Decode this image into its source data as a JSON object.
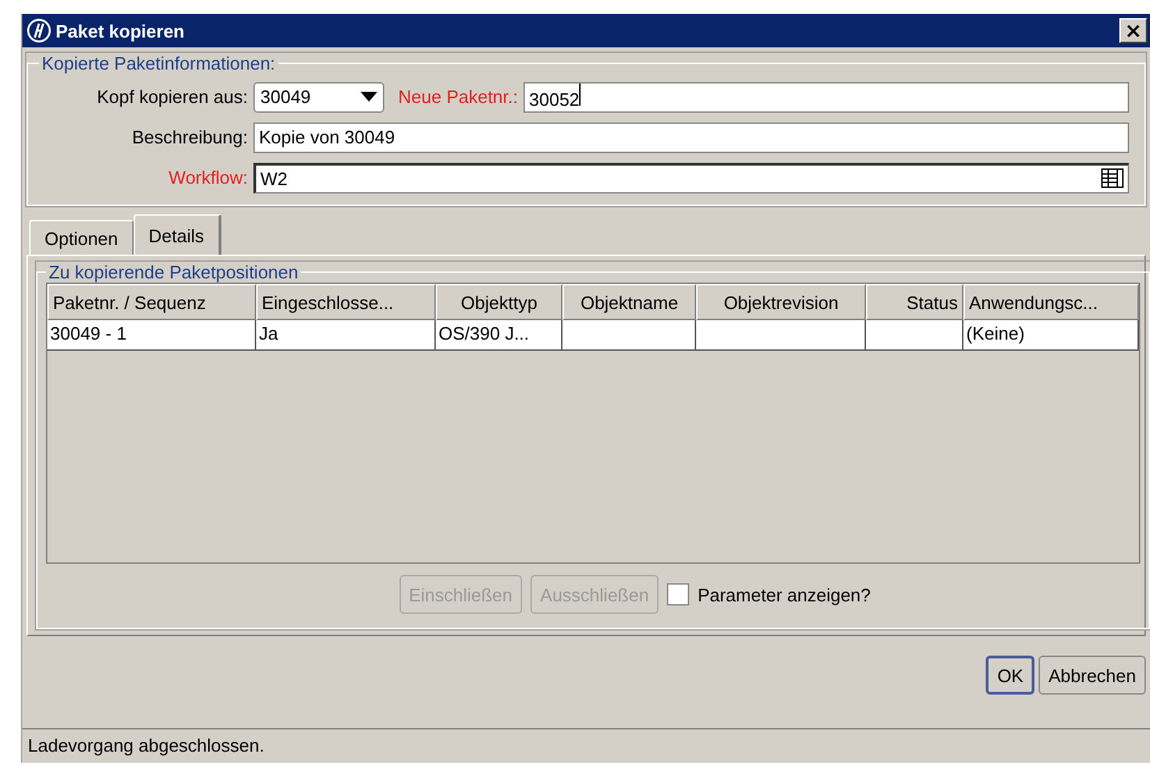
{
  "window": {
    "title": "Paket kopieren",
    "close": "×"
  },
  "info_group": {
    "title": "Kopierte Paketinformationen:",
    "fields": [
      {
        "kind": "combo",
        "label": "Kopf kopieren aus:",
        "required": false,
        "value": "30049"
      },
      {
        "kind": "text",
        "label": "Neue Paketnr.:",
        "required": true,
        "value": "30052"
      },
      {
        "kind": "text",
        "label": "Beschreibung:",
        "required": false,
        "value": "Kopie von 30049"
      },
      {
        "kind": "lookup",
        "label": "Workflow:",
        "required": true,
        "value": "W2"
      }
    ]
  },
  "tabs": [
    {
      "label": "Optionen",
      "selected": false
    },
    {
      "label": "Details",
      "selected": true
    }
  ],
  "positions_group": {
    "title": "Zu kopierende Paketpositionen",
    "table": {
      "columns": [
        "Paketnr. / Sequenz",
        "Eingeschlosse...",
        "Objekttyp",
        "Objektname",
        "Objektrevision",
        "Status",
        "Anwendungsc..."
      ],
      "rows": [
        [
          "30049 - 1",
          "Ja",
          "OS/390 J...",
          "",
          "",
          "",
          "(Keine)"
        ]
      ]
    },
    "buttons": [
      {
        "label": "Einschließen",
        "disabled": true
      },
      {
        "label": "Ausschließen",
        "disabled": true
      }
    ],
    "checkbox": {
      "label": "Parameter anzeigen?",
      "checked": false
    }
  },
  "dialog_buttons": [
    {
      "label": "OK",
      "default": true
    },
    {
      "label": "Abbrechen",
      "default": false
    }
  ],
  "status_bar": "Ladevorgang abgeschlossen."
}
